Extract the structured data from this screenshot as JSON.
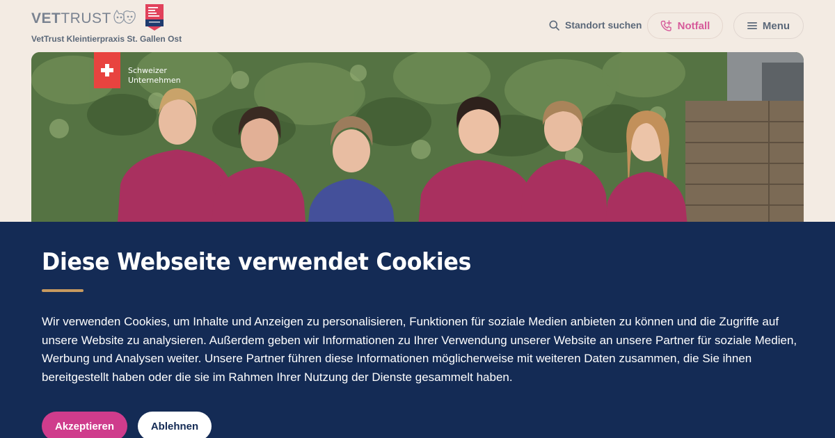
{
  "header": {
    "logo_text_bold": "VET",
    "logo_text_rest": "TRUST",
    "practice_name": "VetTrust Kleintierpraxis St. Gallen Ost",
    "search_label": "Standort suchen",
    "notfall_label": "Notfall",
    "menu_label": "Menu",
    "icons": [
      "search-icon",
      "phone-icon",
      "hamburger-icon"
    ],
    "colors": {
      "notfall": "#d65a9a",
      "text": "#5b6879",
      "background": "#f3ebe3"
    }
  },
  "hero": {
    "badge_line1": "Schweizer",
    "badge_line2": "Unternehmen",
    "badge_color": "#e8433f"
  },
  "cookie_banner": {
    "title": "Diese Webseite verwendet Cookies",
    "text": "Wir verwenden Cookies, um Inhalte und Anzeigen zu personalisieren, Funktionen für soziale Medien anbieten zu können und die Zugriffe auf unsere Website zu analysieren. Außerdem geben wir Informationen zu Ihrer Verwendung unserer Website an unsere Partner für soziale Medien, Werbung und Analysen weiter. Unsere Partner führen diese Informationen möglicherweise mit weiteren Daten zusammen, die Sie ihnen bereitgestellt haben oder die sie im Rahmen Ihrer Nutzung der Dienste gesammelt haben.",
    "accept_label": "Akzeptieren",
    "reject_label": "Ablehnen",
    "colors": {
      "background": "#142b55",
      "accent": "#c79a5f",
      "accept": "#cf3c8c"
    }
  }
}
